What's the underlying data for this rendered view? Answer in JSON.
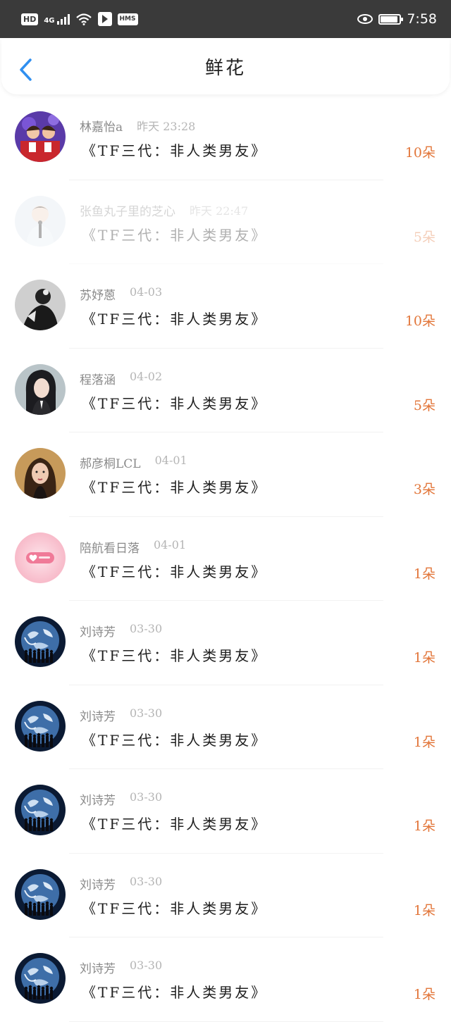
{
  "status_bar": {
    "hd": "HD",
    "network": "4G",
    "hms": "HMS",
    "time": "7:58"
  },
  "nav": {
    "title": "鲜花"
  },
  "items": [
    {
      "user": "林嘉怡a",
      "date": "昨天 23:28",
      "work": "《TF三代：非人类男友》",
      "count": "10朵",
      "avatar": "photo-two-kids"
    },
    {
      "user": "张鱼丸子里的芝心",
      "date": "昨天 22:47",
      "work": "《TF三代：非人类男友》",
      "count": "5朵",
      "avatar": "photo-boy-microphone"
    },
    {
      "user": "苏妤蒽",
      "date": "04-03",
      "work": "《TF三代：非人类男友》",
      "count": "10朵",
      "avatar": "photo-dark-figure"
    },
    {
      "user": "程落涵",
      "date": "04-02",
      "work": "《TF三代：非人类男友》",
      "count": "5朵",
      "avatar": "photo-woman-dark-hair"
    },
    {
      "user": "郝彦桐LCL",
      "date": "04-01",
      "work": "《TF三代：非人类男友》",
      "count": "3朵",
      "avatar": "photo-woman-portrait"
    },
    {
      "user": "陪航看日落",
      "date": "04-01",
      "work": "《TF三代：非人类男友》",
      "count": "1朵",
      "avatar": "pink-heart-toggle"
    },
    {
      "user": "刘诗芳",
      "date": "03-30",
      "work": "《TF三代：非人类男友》",
      "count": "1朵",
      "avatar": "earth-silhouettes"
    },
    {
      "user": "刘诗芳",
      "date": "03-30",
      "work": "《TF三代：非人类男友》",
      "count": "1朵",
      "avatar": "earth-silhouettes"
    },
    {
      "user": "刘诗芳",
      "date": "03-30",
      "work": "《TF三代：非人类男友》",
      "count": "1朵",
      "avatar": "earth-silhouettes"
    },
    {
      "user": "刘诗芳",
      "date": "03-30",
      "work": "《TF三代：非人类男友》",
      "count": "1朵",
      "avatar": "earth-silhouettes"
    },
    {
      "user": "刘诗芳",
      "date": "03-30",
      "work": "《TF三代：非人类男友》",
      "count": "1朵",
      "avatar": "earth-silhouettes"
    }
  ],
  "faded_item": 1,
  "colors": {
    "accent_blue": "#2f8ff0",
    "count_orange": "#e2763a",
    "status_bar_bg": "#3a3a3a"
  }
}
